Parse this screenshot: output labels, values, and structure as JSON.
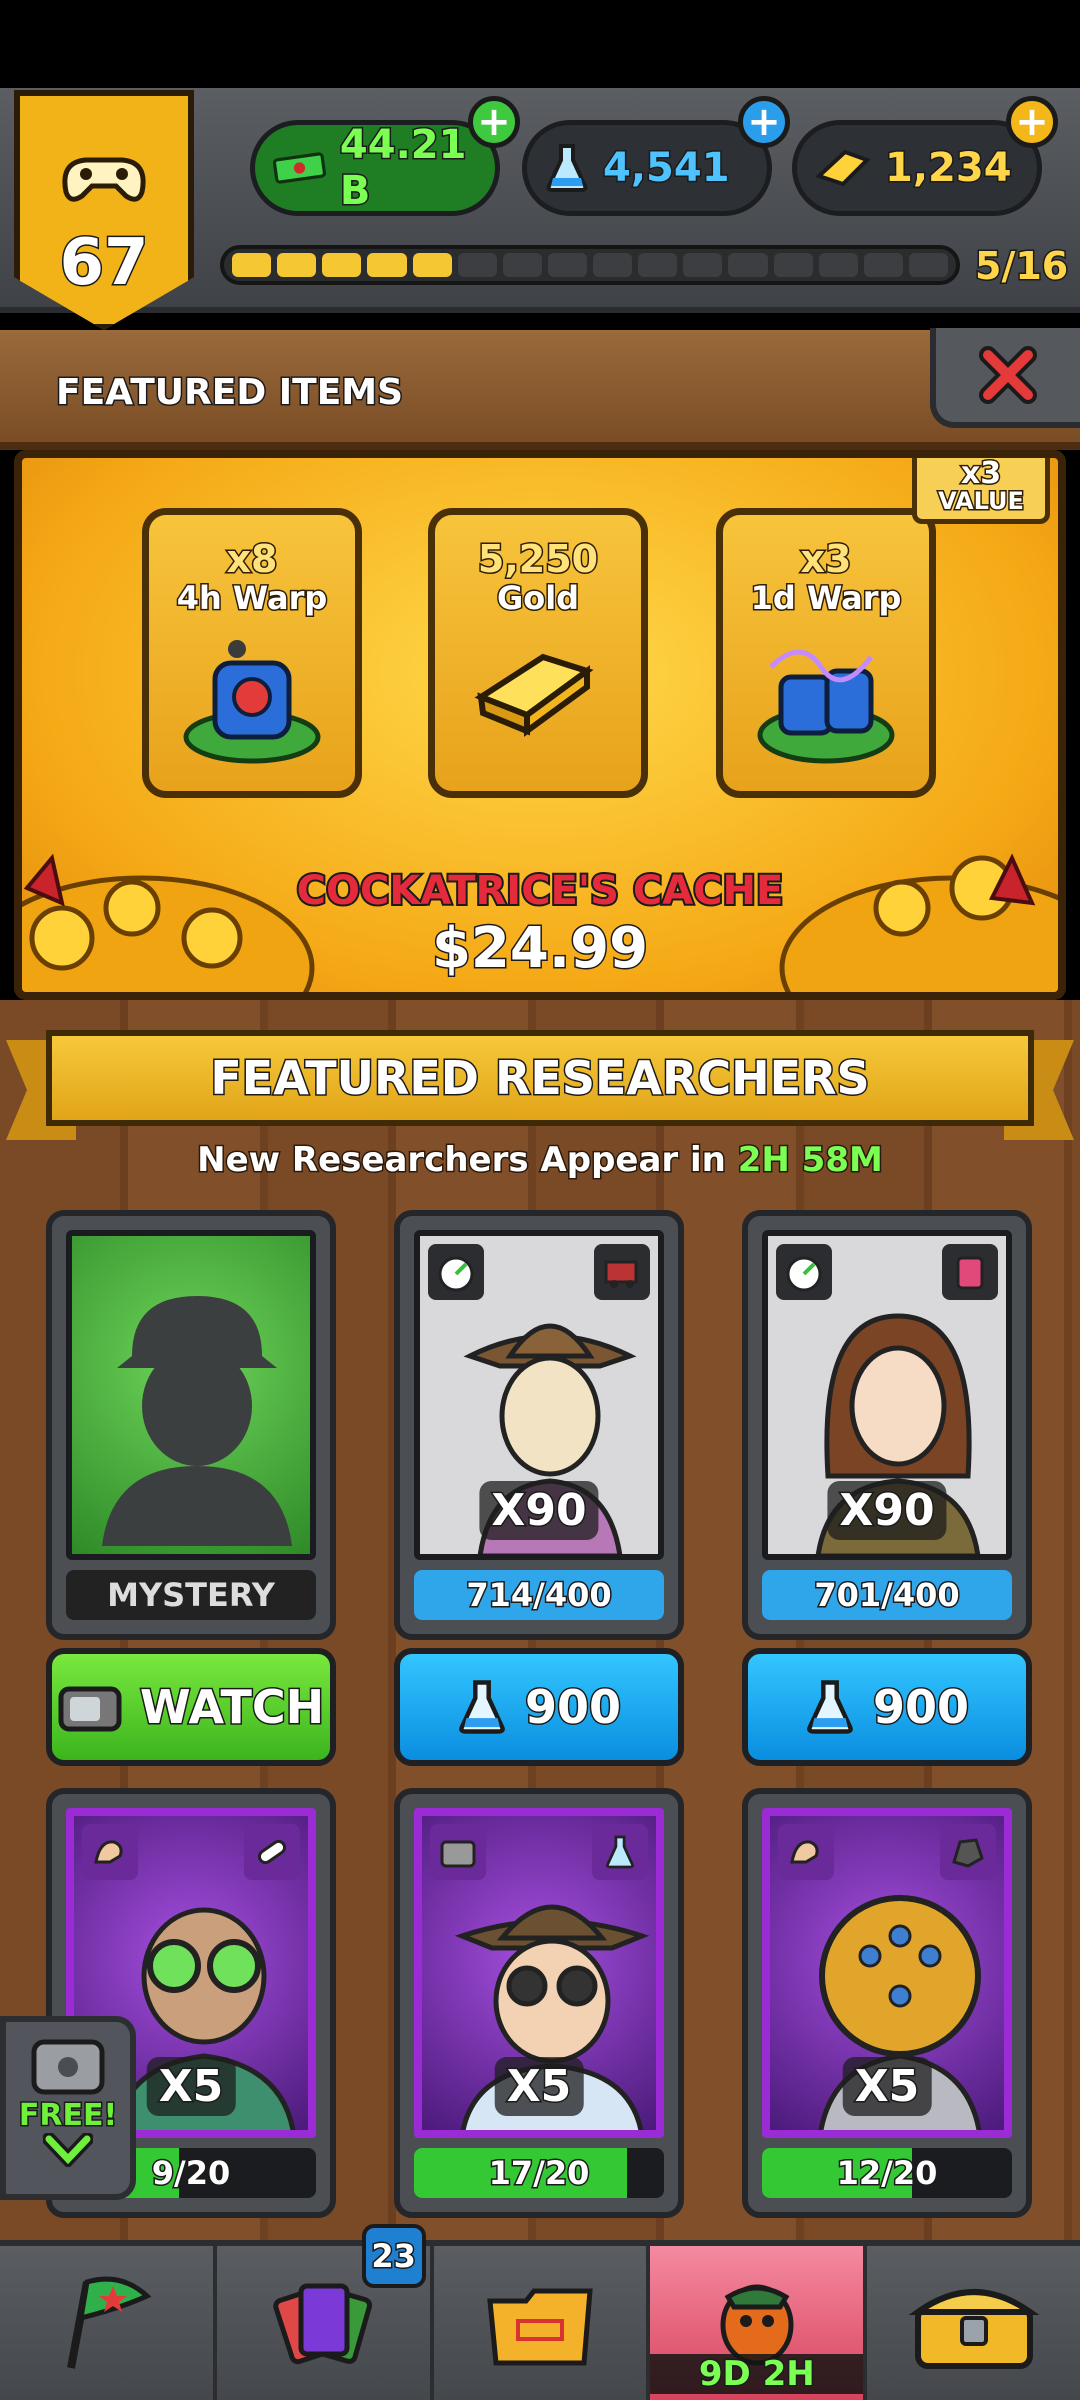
{
  "header": {
    "level": "67",
    "currencies": [
      {
        "name": "cash",
        "value": "44.21 B",
        "color": "#37c13b"
      },
      {
        "name": "science",
        "value": "4,541",
        "color": "#3aaaf0"
      },
      {
        "name": "gold",
        "value": "1,234",
        "color": "#f4c21d"
      }
    ],
    "progress_text": "5/16",
    "progress_filled": 5,
    "progress_total": 16
  },
  "featured_items": {
    "title": "FEATURED ITEMS",
    "close_icon": "close-icon",
    "value_tag": "x3",
    "value_tag_label": "VALUE",
    "cards": [
      {
        "qty": "x8",
        "name": "4h Warp",
        "icon": "warp-machine-icon"
      },
      {
        "qty": "5,250",
        "name": "Gold",
        "icon": "gold-bars-icon"
      },
      {
        "qty": "x3",
        "name": "1d Warp",
        "icon": "warp-machine-icon"
      }
    ],
    "bundle_name": "COCKATRICE'S CACHE",
    "price": "$24.99"
  },
  "featured_researchers": {
    "title": "FEATURED RESEARCHERS",
    "timer_prefix": "New Researchers Appear in",
    "timer_value": "2H 58M",
    "row1": [
      {
        "label": "MYSTERY",
        "multiplier": "",
        "progress": "",
        "fill": 1.0,
        "button": "WATCH",
        "button_type": "watch"
      },
      {
        "label": "",
        "multiplier": "X90",
        "progress": "714/400",
        "fill": 1.0,
        "button": "900",
        "button_type": "buy"
      },
      {
        "label": "",
        "multiplier": "X90",
        "progress": "701/400",
        "fill": 1.0,
        "button": "900",
        "button_type": "buy"
      }
    ],
    "row2": [
      {
        "multiplier": "X5",
        "progress": "9/20",
        "fill": 0.45
      },
      {
        "multiplier": "X5",
        "progress": "17/20",
        "fill": 0.85
      },
      {
        "multiplier": "X5",
        "progress": "12/20",
        "fill": 0.6
      }
    ]
  },
  "free_button": {
    "label": "FREE!"
  },
  "bottom_nav": {
    "items": [
      {
        "name": "flag",
        "badge": ""
      },
      {
        "name": "cards",
        "badge": "23"
      },
      {
        "name": "files",
        "badge": ""
      },
      {
        "name": "event",
        "badge": "",
        "timer": "9D 2H"
      },
      {
        "name": "shop",
        "badge": ""
      }
    ]
  }
}
